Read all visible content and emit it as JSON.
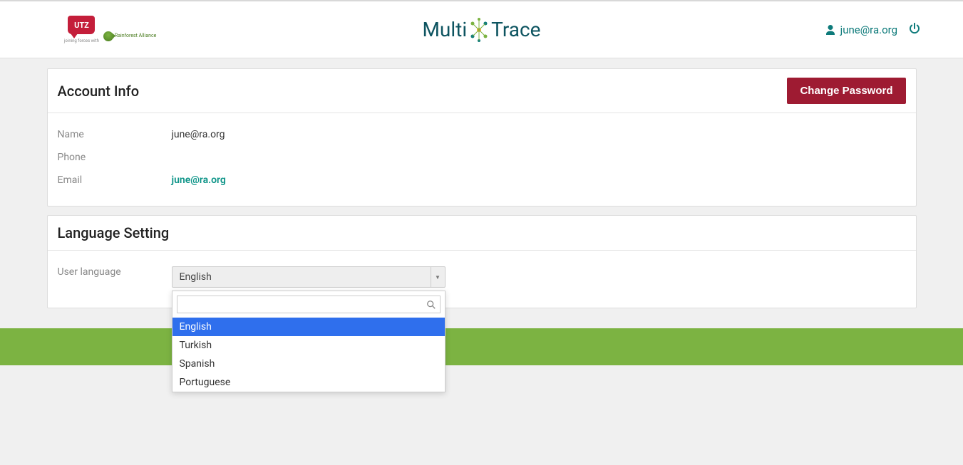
{
  "header": {
    "logo": {
      "utz_text": "UTZ",
      "joining_text": "joining forces with",
      "ra_text": "Rainforest Alliance"
    },
    "center_logo": {
      "multi": "Multi",
      "trace": "Trace"
    },
    "user_email": "june@ra.org"
  },
  "account_info": {
    "title": "Account Info",
    "change_password_label": "Change Password",
    "fields": {
      "name": {
        "label": "Name",
        "value": "june@ra.org"
      },
      "phone": {
        "label": "Phone",
        "value": ""
      },
      "email": {
        "label": "Email",
        "value": "june@ra.org"
      }
    }
  },
  "language_setting": {
    "title": "Language Setting",
    "label": "User language",
    "selected": "English",
    "search_placeholder": "",
    "options": [
      "English",
      "Turkish",
      "Spanish",
      "Portuguese"
    ]
  }
}
